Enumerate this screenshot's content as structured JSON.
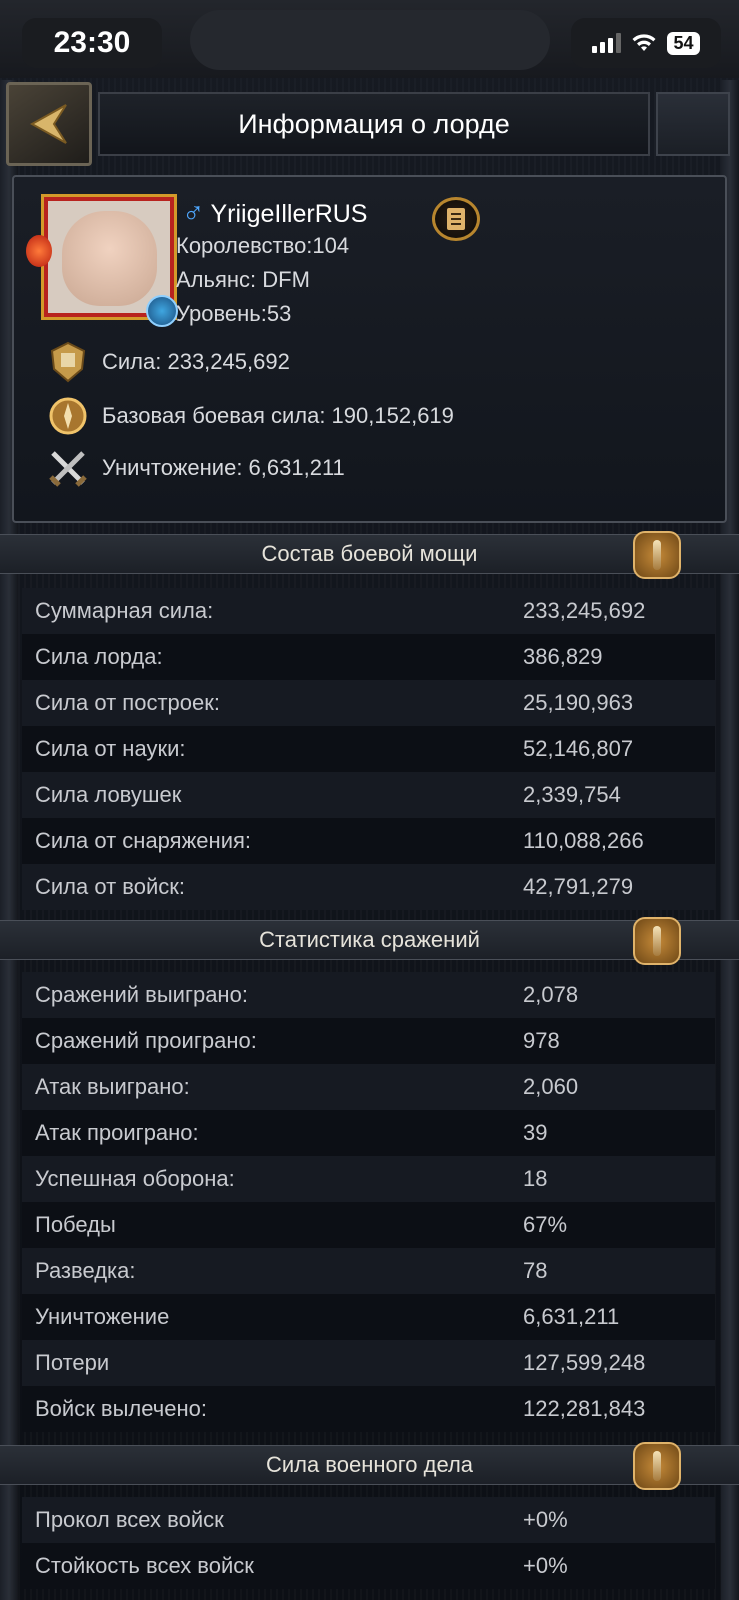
{
  "status_bar": {
    "time": "23:30",
    "battery": "54"
  },
  "header": {
    "title": "Информация о лорде"
  },
  "profile": {
    "name": "YriigeIllerRUS",
    "kingdom": "Королевство:104",
    "alliance": "Альянс: DFM",
    "level": "Уровень:53",
    "stats": [
      {
        "label": "Сила: 233,245,692",
        "icon": "power-icon"
      },
      {
        "label": "Базовая боевая сила: 190,152,619",
        "icon": "base-combat-icon"
      },
      {
        "label": "Уничтожение: 6,631,211",
        "icon": "crossed-swords-icon"
      }
    ]
  },
  "sections": {
    "power_composition": {
      "title": "Состав боевой мощи",
      "rows": [
        {
          "label": "Суммарная сила:",
          "value": "233,245,692"
        },
        {
          "label": "Сила лорда:",
          "value": "386,829"
        },
        {
          "label": "Сила от построек:",
          "value": "25,190,963"
        },
        {
          "label": "Сила от науки:",
          "value": "52,146,807"
        },
        {
          "label": "Сила ловушек",
          "value": "2,339,754"
        },
        {
          "label": "Сила от снаряжения:",
          "value": "110,088,266"
        },
        {
          "label": "Сила от войск:",
          "value": "42,791,279"
        }
      ]
    },
    "battle_stats": {
      "title": "Статистика сражений",
      "rows": [
        {
          "label": "Сражений выиграно:",
          "value": "2,078"
        },
        {
          "label": "Сражений проиграно:",
          "value": "978"
        },
        {
          "label": "Атак выиграно:",
          "value": "2,060"
        },
        {
          "label": "Атак проиграно:",
          "value": "39"
        },
        {
          "label": "Успешная оборона:",
          "value": "18"
        },
        {
          "label": "Победы",
          "value": "67%"
        },
        {
          "label": "Разведка:",
          "value": "78"
        },
        {
          "label": "Уничтожение",
          "value": "6,631,211"
        },
        {
          "label": "Потери",
          "value": "127,599,248"
        },
        {
          "label": "Войск вылечено:",
          "value": "122,281,843"
        }
      ]
    },
    "military_power": {
      "title": "Сила военного дела",
      "rows": [
        {
          "label": "Прокол всех войск",
          "value": "+0%"
        },
        {
          "label": "Стойкость всех войск",
          "value": "+0%"
        }
      ]
    }
  }
}
